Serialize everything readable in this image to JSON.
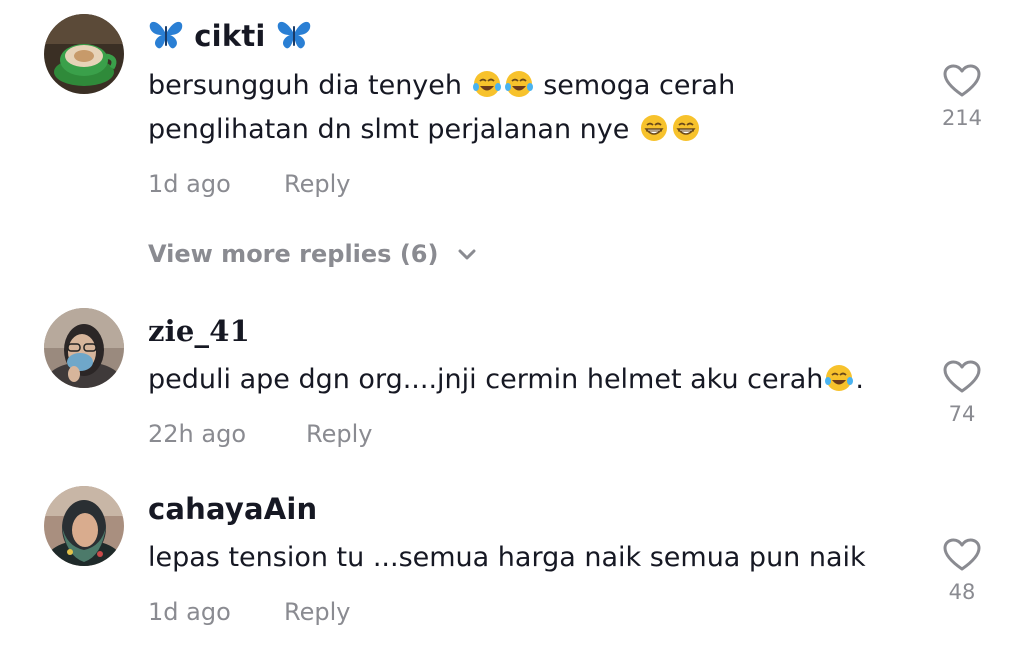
{
  "comments": [
    {
      "username": "cikti",
      "text_line1_a": "bersungguh dia tenyeh",
      "text_line1_b": "semoga cerah",
      "text_line2": "penglihatan dn slmt perjalanan nye",
      "time": "1d ago",
      "reply_label": "Reply",
      "likes": "214",
      "emojis": [
        "face-with-tears-of-joy-icon",
        "face-with-tears-of-joy-icon",
        "grinning-face-icon",
        "grinning-face-icon"
      ],
      "username_icons": [
        "butterfly-icon",
        "butterfly-icon"
      ]
    },
    {
      "username": "zie_41",
      "text_a": "peduli ape dgn org....jnji cermin helmet aku cerah",
      "text_b": ".",
      "time": "22h ago",
      "reply_label": "Reply",
      "likes": "74",
      "emojis": [
        "face-with-tears-of-joy-icon"
      ]
    },
    {
      "username": "cahayaAin",
      "text": "lepas tension tu ...semua harga naik semua pun naik",
      "time": "1d ago",
      "reply_label": "Reply",
      "likes": "48"
    }
  ],
  "view_more": {
    "label": "View more replies (6)",
    "icon": "chevron-down-icon"
  },
  "colors": {
    "text_primary": "#161823",
    "text_secondary": "#8a8b91",
    "butterfly": "#2a7fd4",
    "emoji_face": "#f7c22c"
  }
}
